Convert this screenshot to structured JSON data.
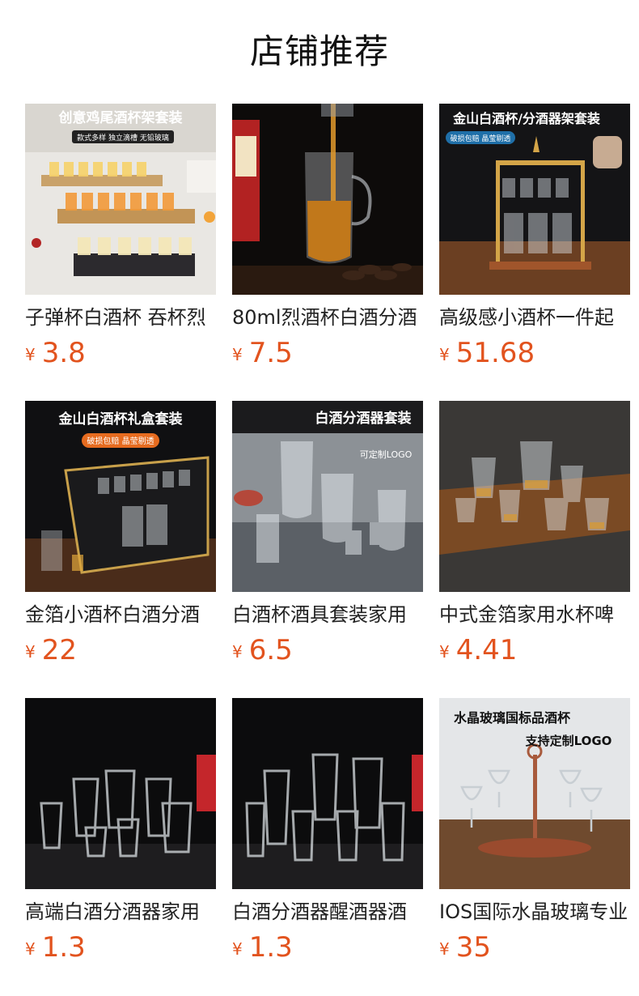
{
  "page": {
    "title": "店铺推荐",
    "currency_symbol": "¥"
  },
  "colors": {
    "price": "#e2531e",
    "text": "#222222",
    "background": "#ffffff"
  },
  "products": [
    {
      "name": "子弹杯白酒杯 吞杯烈",
      "price": "3.8",
      "image_banner": "创意鸡尾酒杯架套装",
      "image_subtext": "款式多样 独立滴槽 无铅玻璃"
    },
    {
      "name": "80ml烈酒杯白酒分酒",
      "price": "7.5",
      "image_banner": "",
      "image_subtext": ""
    },
    {
      "name": "高级感小酒杯一件起",
      "price": "51.68",
      "image_banner": "金山白酒杯/分酒器架套装",
      "image_subtext": "破损包赔 晶莹剔透"
    },
    {
      "name": "金箔小酒杯白酒分酒",
      "price": "22",
      "image_banner": "金山白酒杯礼盒套装",
      "image_subtext": "破损包赔 晶莹剔透"
    },
    {
      "name": "白酒杯酒具套装家用",
      "price": "6.5",
      "image_banner": "白酒分酒器套装",
      "image_subtext": "可定制LOGO"
    },
    {
      "name": "中式金箔家用水杯啤",
      "price": "4.41",
      "image_banner": "",
      "image_subtext": ""
    },
    {
      "name": "高端白酒分酒器家用",
      "price": "1.3",
      "image_banner": "",
      "image_subtext": ""
    },
    {
      "name": "白酒分酒器醒酒器酒",
      "price": "1.3",
      "image_banner": "",
      "image_subtext": ""
    },
    {
      "name": "IOS国际水晶玻璃专业",
      "price": "35",
      "image_banner": "水晶玻璃国标品酒杯",
      "image_subtext": "支持定制LOGO"
    }
  ]
}
